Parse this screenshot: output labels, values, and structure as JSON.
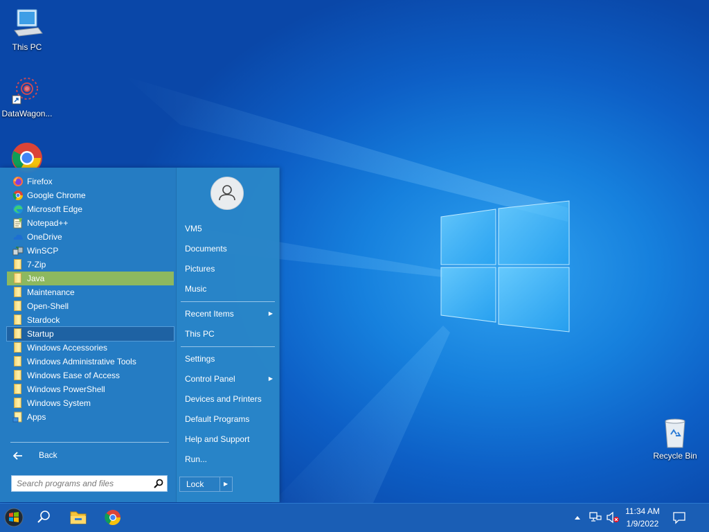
{
  "desktop": {
    "icons": [
      {
        "label": "This PC",
        "icon": "computer-icon"
      },
      {
        "label": "DataWagon...",
        "icon": "datawagon-icon"
      },
      {
        "label": "Recycle Bin",
        "icon": "recycle-bin-icon"
      }
    ]
  },
  "start_menu": {
    "programs": [
      {
        "label": "Firefox",
        "icon": "firefox-icon"
      },
      {
        "label": "Google Chrome",
        "icon": "chrome-icon"
      },
      {
        "label": "Microsoft Edge",
        "icon": "edge-icon"
      },
      {
        "label": "Notepad++",
        "icon": "notepad-plus-icon"
      },
      {
        "label": "OneDrive",
        "icon": "onedrive-icon"
      },
      {
        "label": "WinSCP",
        "icon": "winscp-icon"
      },
      {
        "label": "7-Zip",
        "icon": "folder-icon"
      },
      {
        "label": "Java",
        "icon": "folder-icon",
        "state": "highlighted"
      },
      {
        "label": "Maintenance",
        "icon": "folder-icon"
      },
      {
        "label": "Open-Shell",
        "icon": "folder-icon"
      },
      {
        "label": "Stardock",
        "icon": "folder-icon"
      },
      {
        "label": "Startup",
        "icon": "folder-icon",
        "state": "selected"
      },
      {
        "label": "Windows Accessories",
        "icon": "folder-icon"
      },
      {
        "label": "Windows Administrative Tools",
        "icon": "folder-icon"
      },
      {
        "label": "Windows Ease of Access",
        "icon": "folder-icon"
      },
      {
        "label": "Windows PowerShell",
        "icon": "folder-icon"
      },
      {
        "label": "Windows System",
        "icon": "folder-icon"
      },
      {
        "label": "Apps",
        "icon": "apps-folder-icon"
      }
    ],
    "back_label": "Back",
    "search_placeholder": "Search programs and files",
    "right": {
      "user": "VM5",
      "documents": "Documents",
      "pictures": "Pictures",
      "music": "Music",
      "recent_items": "Recent Items",
      "this_pc": "This PC",
      "settings": "Settings",
      "control_panel": "Control Panel",
      "devices_printers": "Devices and Printers",
      "default_programs": "Default Programs",
      "help_support": "Help and Support",
      "run": "Run..."
    },
    "lock_label": "Lock"
  },
  "taskbar": {
    "time": "11:34 AM",
    "date": "1/9/2022"
  },
  "colors": {
    "menu_bg": "#267ec4",
    "highlight": "#8db85f",
    "taskbar": "#1a5eb5"
  }
}
